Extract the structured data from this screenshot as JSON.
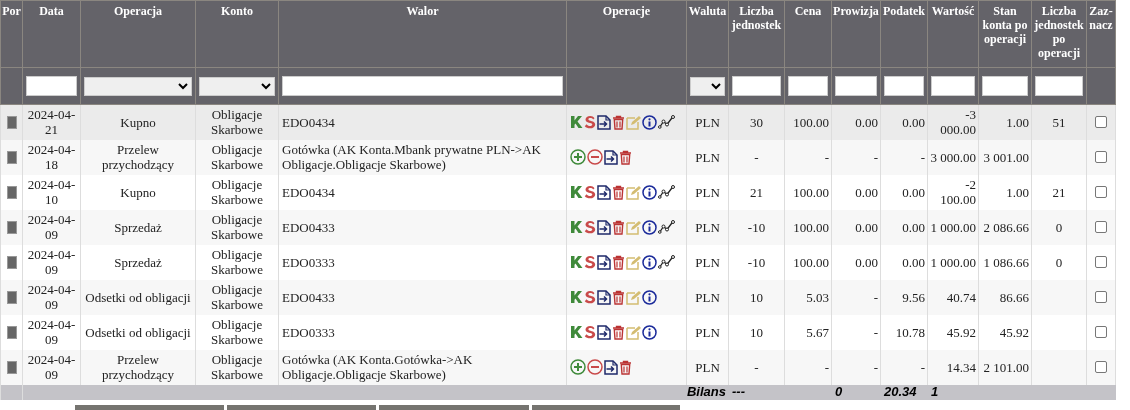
{
  "columns": [
    "Por",
    "Data",
    "Operacja",
    "Konto",
    "Walor",
    "Operacje",
    "Waluta",
    "Liczba jednostek",
    "Cena",
    "Prowizja",
    "Podatek",
    "Wartość",
    "Stan konta po operacji",
    "Liczba jednostek po operacji",
    "Zaz-nacz"
  ],
  "filters": [
    {
      "kind": "none"
    },
    {
      "kind": "text"
    },
    {
      "kind": "select"
    },
    {
      "kind": "select"
    },
    {
      "kind": "text"
    },
    {
      "kind": "none"
    },
    {
      "kind": "select"
    },
    {
      "kind": "text"
    },
    {
      "kind": "text"
    },
    {
      "kind": "text"
    },
    {
      "kind": "text"
    },
    {
      "kind": "text"
    },
    {
      "kind": "text"
    },
    {
      "kind": "text"
    },
    {
      "kind": "none"
    }
  ],
  "rows": [
    {
      "highlighted": true,
      "date": "2024-04-21",
      "operation": "Kupno",
      "account": "Obligacje Skarbowe",
      "asset": "EDO0434",
      "kind": "trade",
      "chart_link": true,
      "currency": "PLN",
      "units": "30",
      "price": "100.00",
      "commission": "0.00",
      "tax": "0.00",
      "value": "-3 000.00",
      "balance": "1.00",
      "units_after": "51",
      "checked": false
    },
    {
      "highlighted": false,
      "date": "2024-04-18",
      "operation": "Przelew przychodzący",
      "account": "Obligacje Skarbowe",
      "asset": "Gotówka (AK Konta.Mbank prywatne PLN->AK Obligacje.Obligacje Skarbowe)",
      "kind": "transfer",
      "chart_link": false,
      "currency": "PLN",
      "units": "-",
      "price": "-",
      "commission": "-",
      "tax": "-",
      "value": "3 000.00",
      "balance": "3 001.00",
      "units_after": "",
      "checked": false
    },
    {
      "highlighted": false,
      "date": "2024-04-10",
      "operation": "Kupno",
      "account": "Obligacje Skarbowe",
      "asset": "EDO0434",
      "kind": "trade",
      "chart_link": true,
      "currency": "PLN",
      "units": "21",
      "price": "100.00",
      "commission": "0.00",
      "tax": "0.00",
      "value": "-2 100.00",
      "balance": "1.00",
      "units_after": "21",
      "checked": false
    },
    {
      "highlighted": false,
      "date": "2024-04-09",
      "operation": "Sprzedaż",
      "account": "Obligacje Skarbowe",
      "asset": "EDO0433",
      "kind": "trade",
      "chart_link": true,
      "currency": "PLN",
      "units": "-10",
      "price": "100.00",
      "commission": "0.00",
      "tax": "0.00",
      "value": "1 000.00",
      "balance": "2 086.66",
      "units_after": "0",
      "checked": false
    },
    {
      "highlighted": false,
      "date": "2024-04-09",
      "operation": "Sprzedaż",
      "account": "Obligacje Skarbowe",
      "asset": "EDO0333",
      "kind": "trade",
      "chart_link": true,
      "currency": "PLN",
      "units": "-10",
      "price": "100.00",
      "commission": "0.00",
      "tax": "0.00",
      "value": "1 000.00",
      "balance": "1 086.66",
      "units_after": "0",
      "checked": false
    },
    {
      "highlighted": false,
      "date": "2024-04-09",
      "operation": "Odsetki od obligacji",
      "account": "Obligacje Skarbowe",
      "asset": "EDO0433",
      "kind": "trade",
      "chart_link": false,
      "currency": "PLN",
      "units": "10",
      "price": "5.03",
      "commission": "-",
      "tax": "9.56",
      "value": "40.74",
      "balance": "86.66",
      "units_after": "",
      "checked": false
    },
    {
      "highlighted": false,
      "date": "2024-04-09",
      "operation": "Odsetki od obligacji",
      "account": "Obligacje Skarbowe",
      "asset": "EDO0333",
      "kind": "trade",
      "chart_link": false,
      "currency": "PLN",
      "units": "10",
      "price": "5.67",
      "commission": "-",
      "tax": "10.78",
      "value": "45.92",
      "balance": "45.92",
      "units_after": "",
      "checked": false
    },
    {
      "highlighted": false,
      "date": "2024-04-09",
      "operation": "Przelew przychodzący",
      "account": "Obligacje Skarbowe",
      "asset": "Gotówka (AK Konta.Gotówka->AK Obligacje.Obligacje Skarbowe)",
      "kind": "transfer",
      "chart_link": false,
      "currency": "PLN",
      "units": "-",
      "price": "-",
      "commission": "-",
      "tax": "-",
      "value": "14.34",
      "balance": "2 101.00",
      "units_after": "",
      "checked": false
    }
  ],
  "summary": {
    "label": "Bilans",
    "units": "---",
    "commission": "0",
    "tax": "20.34",
    "value": "1"
  }
}
